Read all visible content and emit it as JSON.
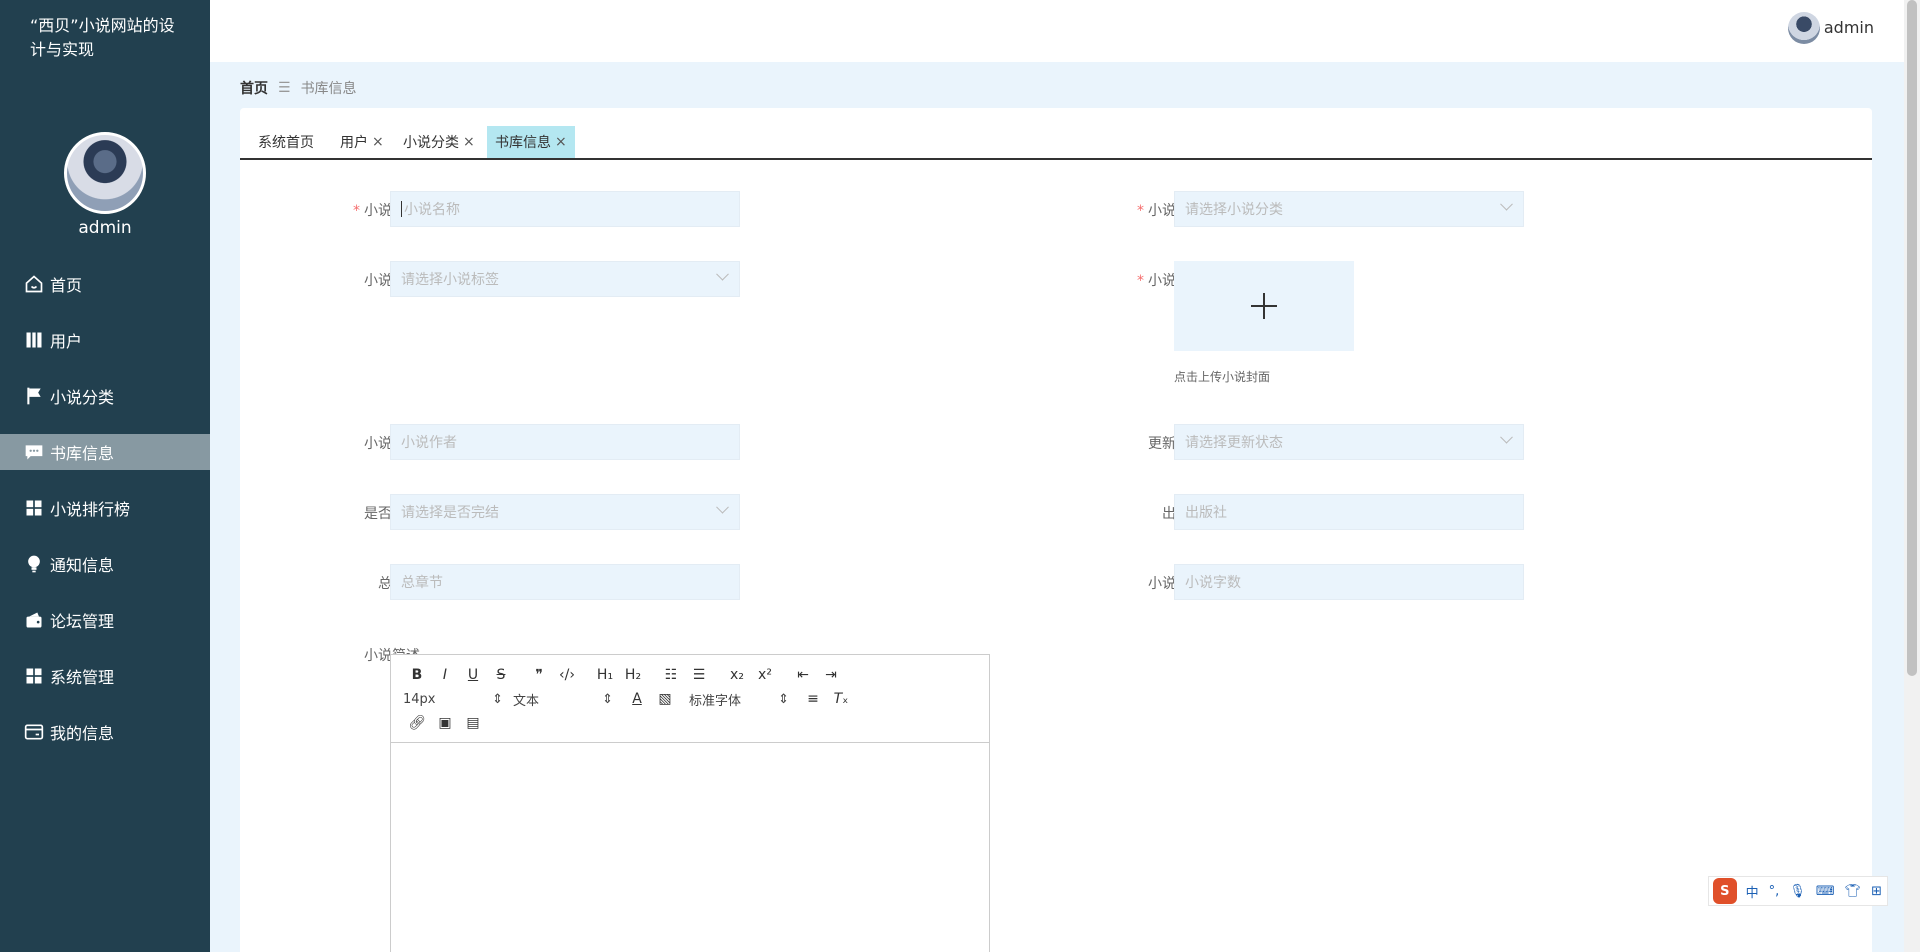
{
  "sidebar": {
    "title": "“西贝”小说网站的设计与实现",
    "username": "admin",
    "items": [
      {
        "label": "首页",
        "icon": "home-icon"
      },
      {
        "label": "用户",
        "icon": "book-icon"
      },
      {
        "label": "小说分类",
        "icon": "flag-icon"
      },
      {
        "label": "书库信息",
        "icon": "chat-icon",
        "active": true
      },
      {
        "label": "小说排行榜",
        "icon": "grid-icon"
      },
      {
        "label": "通知信息",
        "icon": "bulb-icon"
      },
      {
        "label": "论坛管理",
        "icon": "wallet-icon"
      },
      {
        "label": "系统管理",
        "icon": "grid-icon"
      },
      {
        "label": "我的信息",
        "icon": "card-icon"
      }
    ]
  },
  "header": {
    "username": "admin"
  },
  "breadcrumb": {
    "home": "首页",
    "current": "书库信息"
  },
  "tabs": [
    {
      "label": "系统首页",
      "closable": false
    },
    {
      "label": "用户",
      "closable": true
    },
    {
      "label": "小说分类",
      "closable": true
    },
    {
      "label": "书库信息",
      "closable": true,
      "active": true
    }
  ],
  "form": {
    "name": {
      "label": "小说名称",
      "placeholder": "小说名称"
    },
    "category": {
      "label": "小说分类",
      "placeholder": "请选择小说分类"
    },
    "tags": {
      "label": "小说标签",
      "placeholder": "请选择小说标签"
    },
    "cover": {
      "label": "小说封面",
      "hint": "点击上传小说封面"
    },
    "author": {
      "label": "小说作者",
      "placeholder": "小说作者"
    },
    "status": {
      "label": "更新状态",
      "placeholder": "请选择更新状态"
    },
    "finished": {
      "label": "是否完结",
      "placeholder": "请选择是否完结"
    },
    "publisher": {
      "label": "出版社",
      "placeholder": "出版社"
    },
    "chapters": {
      "label": "总章节",
      "placeholder": "总章节"
    },
    "words": {
      "label": "小说字数",
      "placeholder": "小说字数"
    },
    "desc": {
      "label": "小说简述"
    }
  },
  "editor": {
    "font_size": "14px",
    "heading": "文本",
    "font_family": "标准字体"
  },
  "ime": {
    "mode": "中",
    "logo": "S"
  }
}
